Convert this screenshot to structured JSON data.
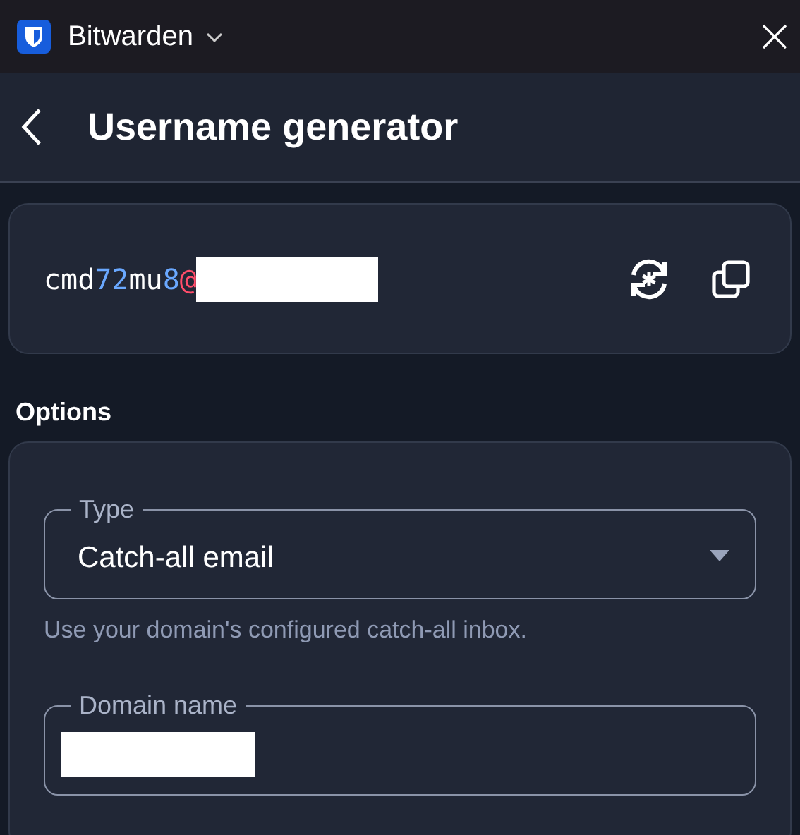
{
  "window": {
    "title": "Bitwarden"
  },
  "header": {
    "title": "Username generator"
  },
  "generated": {
    "segments": [
      {
        "text": "cmd",
        "kind": "letter"
      },
      {
        "text": "72",
        "kind": "number"
      },
      {
        "text": "mu",
        "kind": "letter"
      },
      {
        "text": "8",
        "kind": "number"
      },
      {
        "text": "@",
        "kind": "symbol"
      },
      {
        "kind": "redacted"
      }
    ]
  },
  "options": {
    "title": "Options",
    "type_field": {
      "label": "Type",
      "value": "Catch-all email",
      "hint": "Use your domain's configured catch-all inbox."
    },
    "domain_field": {
      "label": "Domain name",
      "redacted": true
    }
  }
}
